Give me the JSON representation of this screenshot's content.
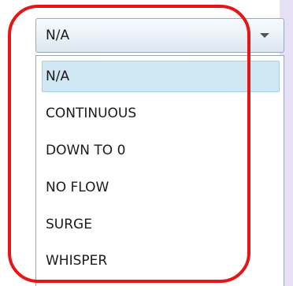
{
  "select": {
    "value": "N/A"
  },
  "options": [
    {
      "label": "N/A",
      "selected": true
    },
    {
      "label": "CONTINUOUS",
      "selected": false
    },
    {
      "label": "DOWN TO 0",
      "selected": false
    },
    {
      "label": "NO FLOW",
      "selected": false
    },
    {
      "label": "SURGE",
      "selected": false
    },
    {
      "label": "WHISPER",
      "selected": false
    }
  ],
  "colors": {
    "selection": "#cfe8f3",
    "annotation": "#e51616",
    "border": "#9aa9bd"
  },
  "icons": {
    "caret": "chevron-down-icon"
  }
}
